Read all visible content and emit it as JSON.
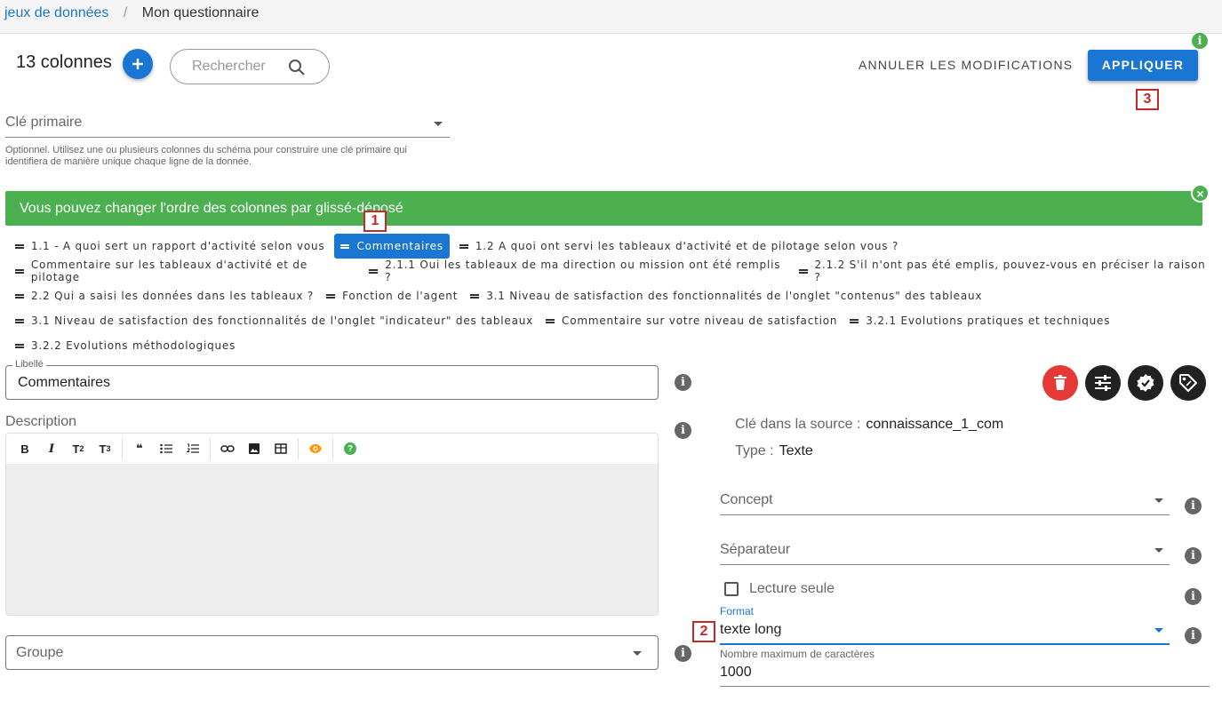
{
  "breadcrumb": {
    "link": "jeux de données",
    "separator": "/",
    "current": "Mon questionnaire"
  },
  "header": {
    "columns_count": "13 colonnes",
    "search_placeholder": "Rechercher",
    "cancel_label": "ANNULER LES MODIFICATIONS",
    "apply_label": "APPLIQUER"
  },
  "primary_key": {
    "label": "Clé primaire",
    "hint": "Optionnel. Utilisez une ou plusieurs colonnes du schéma pour construire une clé primaire qui identifiera de manière unique chaque ligne de la donnée."
  },
  "banner": {
    "text": "Vous pouvez changer l'ordre des colonnes par glissé-déposé"
  },
  "badges": {
    "b1": "1",
    "b2": "2",
    "b3": "3"
  },
  "columns": [
    [
      "1.1 - A quoi sert un rapport d'activité selon vous",
      "Commentaires",
      "1.2 A quoi ont servi les tableaux d'activité et de pilotage selon vous ?"
    ],
    [
      "Commentaire sur les tableaux d'activité et de pilotage",
      "2.1.1 Oui les tableaux de ma direction ou mission ont été remplis ?",
      "2.1.2 S'il n'ont pas été emplis, pouvez-vous en préciser la raison ?"
    ],
    [
      "2.2 Qui a saisi les données dans les tableaux ?",
      "Fonction de l'agent",
      "3.1 Niveau de satisfaction des fonctionnalités de l'onglet \"contenus\" des tableaux"
    ],
    [
      "3.1 Niveau de satisfaction des fonctionnalités de l'onglet \"indicateur\" des tableaux",
      "Commentaire sur votre niveau de satisfaction",
      "3.2.1 Evolutions pratiques et techniques"
    ],
    [
      "3.2.2 Evolutions méthodologiques"
    ]
  ],
  "active_column": "Commentaires",
  "form": {
    "libelle_label": "Libellé",
    "libelle_value": "Commentaires",
    "description_label": "Description",
    "groupe_label": "Groupe"
  },
  "editor_toolbar": {
    "bold": "B",
    "italic": "I",
    "h2": "T",
    "h2_sub": "2",
    "h3": "T",
    "h3_sub": "3",
    "quote": "❝",
    "help": "?"
  },
  "details": {
    "source_key_label": "Clé dans la source :",
    "source_key_value": "connaissance_1_com",
    "type_label": "Type :",
    "type_value": "Texte",
    "concept_label": "Concept",
    "separator_label": "Séparateur",
    "readonly_label": "Lecture seule",
    "format_label": "Format",
    "format_value": "texte long",
    "max_chars_label": "Nombre maximum de caractères",
    "max_chars_value": "1000"
  },
  "icons": {
    "add": "plus-icon",
    "search": "search-icon",
    "close": "close-icon",
    "delete": "delete-icon",
    "settings": "tune-icon",
    "validate": "verified-icon",
    "tag": "tag-icon",
    "info": "info-icon"
  },
  "colors": {
    "primary": "#1976d2",
    "success": "#4caf50",
    "danger": "#e53935",
    "badge": "#c62828"
  }
}
